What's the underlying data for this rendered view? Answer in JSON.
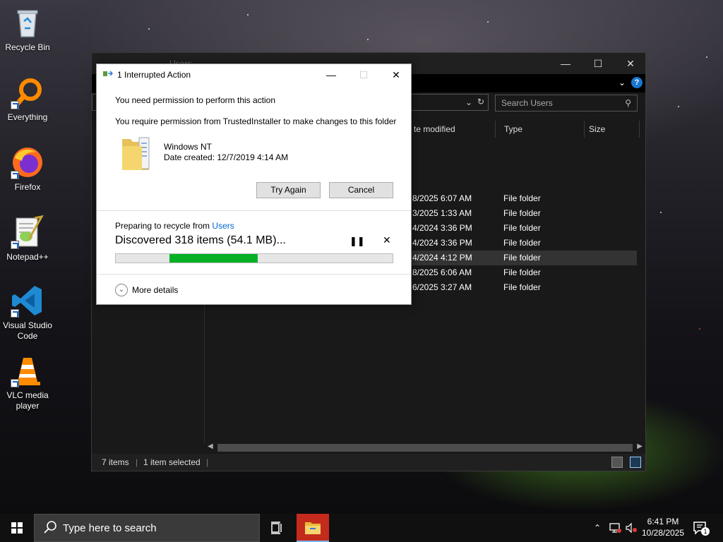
{
  "desktop": {
    "icons": [
      {
        "label": "Recycle Bin"
      },
      {
        "label": "Everything"
      },
      {
        "label": "Firefox"
      },
      {
        "label": "Notepad++"
      },
      {
        "label": "Visual Studio Code"
      },
      {
        "label": "VLC media player"
      }
    ]
  },
  "explorer": {
    "title": "Users",
    "search_placeholder": "Search Users",
    "columns": [
      "te modified",
      "Type",
      "Size"
    ],
    "rows": [
      {
        "date": "8/2025 6:07 AM",
        "type": "File folder",
        "selected": false
      },
      {
        "date": "3/2025 1:33 AM",
        "type": "File folder",
        "selected": false
      },
      {
        "date": "4/2024 3:36 PM",
        "type": "File folder",
        "selected": false
      },
      {
        "date": "4/2024 3:36 PM",
        "type": "File folder",
        "selected": false
      },
      {
        "date": "4/2024 4:12 PM",
        "type": "File folder",
        "selected": true
      },
      {
        "date": "8/2025 6:06 AM",
        "type": "File folder",
        "selected": false
      },
      {
        "date": "6/2025 3:27 AM",
        "type": "File folder",
        "selected": false
      }
    ],
    "status": {
      "item_count": "7 items",
      "selected": "1 item selected"
    }
  },
  "dialog": {
    "title": "1 Interrupted Action",
    "heading": "You need permission to perform this action",
    "message": "You require permission from TrustedInstaller to make changes to this folder",
    "item_name": "Windows NT",
    "item_date": "Date created: 12/7/2019 4:14 AM",
    "try_again_label": "Try Again",
    "cancel_label": "Cancel",
    "preparing_prefix": "Preparing to recycle from",
    "preparing_location": "Users",
    "discovered": "Discovered 318 items (54.1 MB)...",
    "progress_fraction": 0.32,
    "more_details_label": "More details",
    "accent_color": "#0066cc",
    "progress_color": "#06b025"
  },
  "taskbar": {
    "search_placeholder": "Type here to search",
    "time": "6:41 PM",
    "date": "10/28/2025",
    "notification_count": "1",
    "active_app_color": "#c42b1c"
  }
}
